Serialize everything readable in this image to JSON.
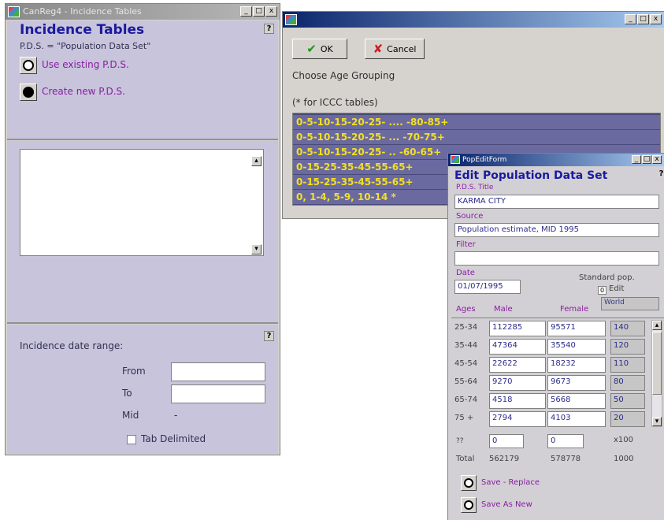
{
  "incidence_window": {
    "title": "CanReg4 - Incidence Tables",
    "heading": "Incidence Tables",
    "subheading": "P.D.S. = \"Population Data Set\"",
    "help": "?",
    "use_existing": "Use existing P.D.S.",
    "create_new": "Create new P.D.S.",
    "date_range_label": "Incidence date range:",
    "from_label": "From",
    "to_label": "To",
    "mid_label": "Mid",
    "mid_value": "-",
    "tab_delimited": "Tab Delimited"
  },
  "age_window": {
    "title": "",
    "ok": "OK",
    "cancel": "Cancel",
    "choose": "Choose Age Grouping",
    "note": "(* for ICCC tables)",
    "options": [
      "0-5-10-15-20-25- .... -80-85+",
      "0-5-10-15-20-25- ... -70-75+",
      "0-5-10-15-20-25- .. -60-65+",
      "0-15-25-35-45-55-65+",
      "0-15-25-35-45-55-65+",
      "0, 1-4, 5-9, 10-14  *"
    ]
  },
  "pop_window": {
    "title": "PopEditForm",
    "heading": "Edit Population Data Set",
    "title_label": "P.D.S. Title",
    "title_value": "KARMA CITY",
    "source_label": "Source",
    "source_value": "Population estimate, MID 1995",
    "filter_label": "Filter",
    "filter_value": "",
    "date_label": "Date",
    "date_value": "01/07/1995",
    "standard_label": "Standard pop.",
    "edit_label": "Edit",
    "edit_btn": "0",
    "standard_value": "World",
    "col_ages": "Ages",
    "col_male": "Male",
    "col_female": "Female",
    "rows": [
      {
        "age": "25-34",
        "male": "112285",
        "female": "95571",
        "std": "140"
      },
      {
        "age": "35-44",
        "male": "47364",
        "female": "35540",
        "std": "120"
      },
      {
        "age": "45-54",
        "male": "22622",
        "female": "18232",
        "std": "110"
      },
      {
        "age": "55-64",
        "male": "9270",
        "female": "9673",
        "std": "80"
      },
      {
        "age": "65-74",
        "male": "4518",
        "female": "5668",
        "std": "50"
      },
      {
        "age": "75 +",
        "male": "2794",
        "female": "4103",
        "std": "20"
      }
    ],
    "unknown_label": "??",
    "unknown_male": "0",
    "unknown_female": "0",
    "per": "x100",
    "total_label": "Total",
    "total_male": "562179",
    "total_female": "578778",
    "total_std": "1000",
    "save_replace": "Save - Replace",
    "save_new": "Save As New"
  }
}
